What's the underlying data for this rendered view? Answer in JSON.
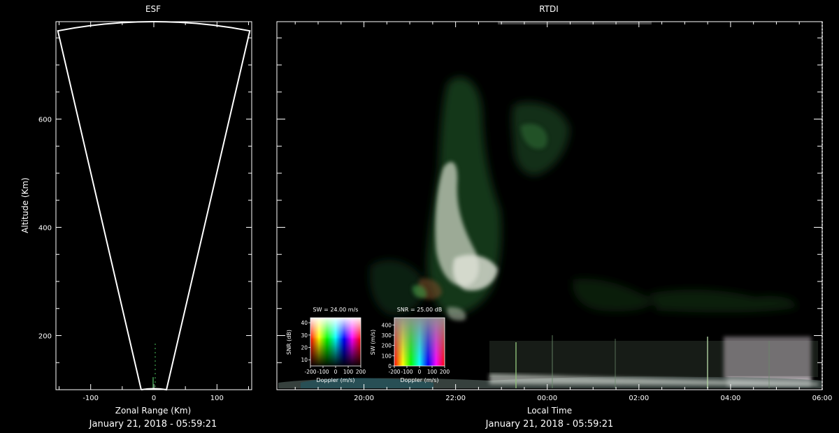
{
  "colors": {
    "background": "#000000",
    "foreground": "#ffffff",
    "echo_green": "#2f7a3a",
    "echo_white": "#d8ddd0"
  },
  "chart_data": [
    {
      "type": "heatmap",
      "title": "ESF",
      "xlabel": "Zonal Range (Km)",
      "ylabel": "Altitude (Km)",
      "xlim": [
        -155,
        155
      ],
      "ylim": [
        100,
        780
      ],
      "xticks": [
        -100,
        0,
        100
      ],
      "yticks": [
        200,
        400,
        600
      ],
      "footer": "January 21, 2018 - 05:59:21",
      "beam_outline": {
        "left_edge": [
          [
            -20,
            100
          ],
          [
            -152,
            763
          ]
        ],
        "right_edge": [
          [
            20,
            100
          ],
          [
            152,
            763
          ]
        ],
        "arc_apex": [
          0,
          780
        ],
        "inner_arc_apex": [
          0,
          102
        ]
      }
    },
    {
      "type": "heatmap",
      "title": "RTDI",
      "xlabel": "Local Time",
      "footer": "January 21, 2018 - 05:59:21",
      "xlim_hours": [
        18.1,
        30.0
      ],
      "ylim": [
        100,
        780
      ],
      "xticks": [
        {
          "value": 20,
          "label": "20:00"
        },
        {
          "value": 22,
          "label": "22:00"
        },
        {
          "value": 24,
          "label": "00:00"
        },
        {
          "value": 26,
          "label": "02:00"
        },
        {
          "value": 28,
          "label": "04:00"
        },
        {
          "value": 30,
          "label": "06:00"
        }
      ],
      "yticks": [
        200,
        400,
        600
      ]
    },
    {
      "type": "heatmap",
      "title": "SW = 24.00 m/s",
      "xlabel": "Doppler (m/s)",
      "ylabel": "SNR (dB)",
      "xticks": [
        "-200",
        "-100",
        "0",
        "100",
        "200"
      ],
      "yticks": [
        "10",
        "20",
        "30",
        "40"
      ],
      "ylim": [
        5,
        44
      ]
    },
    {
      "type": "heatmap",
      "title": "SNR = 25.00 dB",
      "xlabel": "Doppler (m/s)",
      "ylabel": "SW (m/s)",
      "xticks": [
        "-200",
        "-100",
        "0",
        "100",
        "200"
      ],
      "yticks": [
        "0",
        "100",
        "200",
        "300",
        "400"
      ],
      "ylim": [
        0,
        470
      ]
    }
  ]
}
